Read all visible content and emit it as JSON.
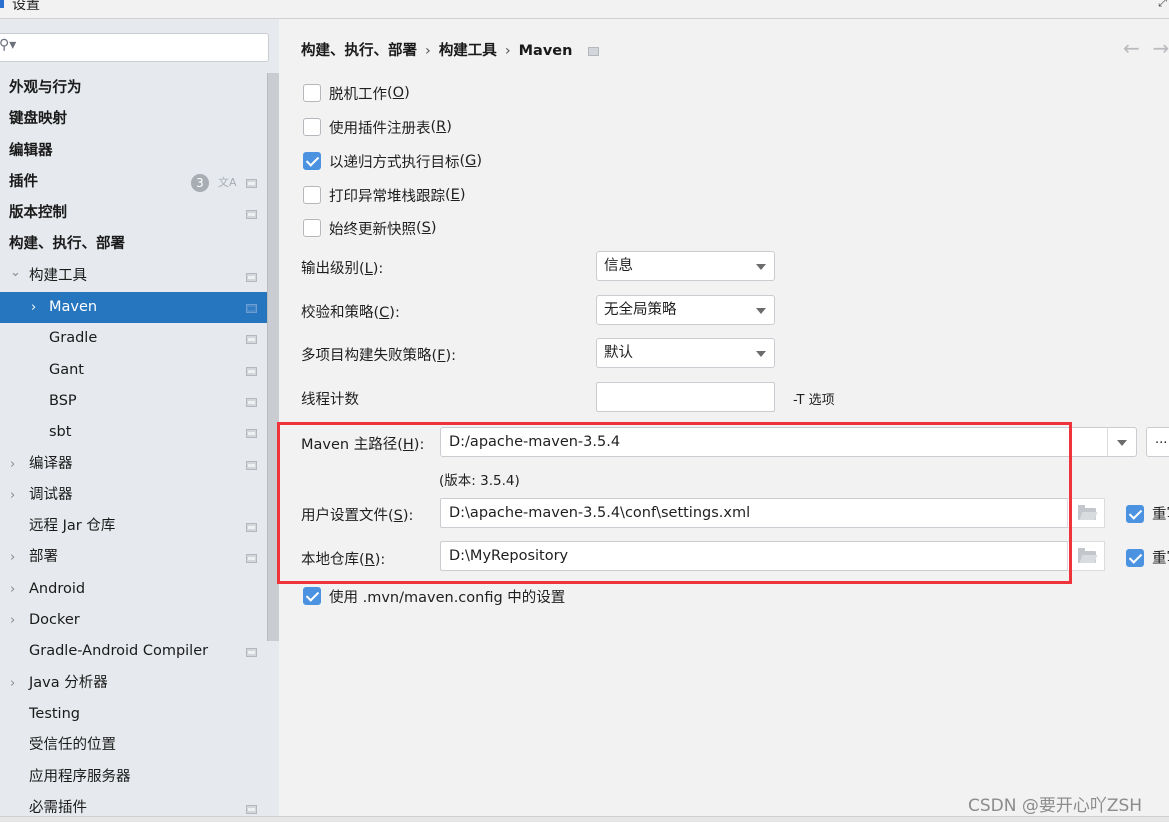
{
  "window": {
    "title": "设置"
  },
  "sidebar": {
    "search_placeholder": "",
    "items": [
      {
        "label": "外观与行为",
        "bold": true,
        "indent": 0,
        "chevron": "",
        "project_icon": false
      },
      {
        "label": "键盘映射",
        "bold": true,
        "indent": 0,
        "chevron": "",
        "project_icon": false
      },
      {
        "label": "编辑器",
        "bold": true,
        "indent": 0,
        "chevron": "",
        "project_icon": false
      },
      {
        "label": "插件",
        "bold": true,
        "indent": 0,
        "chevron": "",
        "project_icon": true,
        "badge": "3",
        "translate_icon": true
      },
      {
        "label": "版本控制",
        "bold": true,
        "indent": 0,
        "chevron": "",
        "project_icon": true
      },
      {
        "label": "构建、执行、部署",
        "bold": true,
        "indent": 0,
        "chevron": "",
        "project_icon": false
      },
      {
        "label": "构建工具",
        "bold": false,
        "indent": 1,
        "chevron": "expanded",
        "project_icon": true
      },
      {
        "label": "Maven",
        "bold": false,
        "indent": 2,
        "chevron": "collapsed",
        "project_icon": true,
        "selected": true
      },
      {
        "label": "Gradle",
        "bold": false,
        "indent": 2,
        "chevron": "",
        "project_icon": true
      },
      {
        "label": "Gant",
        "bold": false,
        "indent": 2,
        "chevron": "",
        "project_icon": true
      },
      {
        "label": "BSP",
        "bold": false,
        "indent": 2,
        "chevron": "",
        "project_icon": true
      },
      {
        "label": "sbt",
        "bold": false,
        "indent": 2,
        "chevron": "",
        "project_icon": true
      },
      {
        "label": "编译器",
        "bold": false,
        "indent": 1,
        "chevron": "collapsed",
        "project_icon": true
      },
      {
        "label": "调试器",
        "bold": false,
        "indent": 1,
        "chevron": "collapsed",
        "project_icon": false
      },
      {
        "label": "远程 Jar 仓库",
        "bold": false,
        "indent": 1,
        "chevron": "",
        "project_icon": true
      },
      {
        "label": "部署",
        "bold": false,
        "indent": 1,
        "chevron": "collapsed",
        "project_icon": true
      },
      {
        "label": "Android",
        "bold": false,
        "indent": 1,
        "chevron": "collapsed",
        "project_icon": false
      },
      {
        "label": "Docker",
        "bold": false,
        "indent": 1,
        "chevron": "collapsed",
        "project_icon": false
      },
      {
        "label": "Gradle-Android Compiler",
        "bold": false,
        "indent": 1,
        "chevron": "",
        "project_icon": true
      },
      {
        "label": "Java 分析器",
        "bold": false,
        "indent": 1,
        "chevron": "collapsed",
        "project_icon": false
      },
      {
        "label": "Testing",
        "bold": false,
        "indent": 1,
        "chevron": "",
        "project_icon": false
      },
      {
        "label": "受信任的位置",
        "bold": false,
        "indent": 1,
        "chevron": "",
        "project_icon": false
      },
      {
        "label": "应用程序服务器",
        "bold": false,
        "indent": 1,
        "chevron": "",
        "project_icon": false
      },
      {
        "label": "必需插件",
        "bold": false,
        "indent": 1,
        "chevron": "",
        "project_icon": true
      }
    ]
  },
  "breadcrumb": {
    "parts": [
      "构建、执行、部署",
      "构建工具",
      "Maven"
    ]
  },
  "options": {
    "work_offline": {
      "label": "脱机工作",
      "mnemonic": "O",
      "checked": false
    },
    "use_plugin_registry": {
      "label": "使用插件注册表",
      "mnemonic": "R",
      "checked": false
    },
    "recursive": {
      "label": "以递归方式执行目标",
      "mnemonic": "G",
      "checked": true
    },
    "print_stacktrace": {
      "label": "打印异常堆栈跟踪",
      "mnemonic": "E",
      "checked": false
    },
    "always_update": {
      "label": "始终更新快照",
      "mnemonic": "S",
      "checked": false
    }
  },
  "fields": {
    "output_level": {
      "label": "输出级别",
      "mnemonic": "L",
      "value": "信息"
    },
    "checksum_policy": {
      "label": "校验和策略",
      "mnemonic": "C",
      "value": "无全局策略"
    },
    "failure_policy": {
      "label": "多项目构建失败策略",
      "mnemonic": "F",
      "value": "默认"
    },
    "thread_count": {
      "label": "线程计数",
      "value": "",
      "hint": "-T 选项"
    },
    "maven_home": {
      "label_prefix": "Maven 主路径",
      "mnemonic": "H",
      "value": "D:/apache-maven-3.5.4",
      "more": "..."
    },
    "version": "(版本: 3.5.4)",
    "user_settings": {
      "label": "用户设置文件",
      "mnemonic": "S",
      "value": "D:\\apache-maven-3.5.4\\conf\\settings.xml",
      "override_checked": true,
      "override_label": "重写"
    },
    "local_repo": {
      "label": "本地仓库",
      "mnemonic": "R",
      "value": "D:\\MyRepository",
      "override_checked": true,
      "override_label": "重写"
    },
    "use_mvn_config": {
      "label": "使用 .mvn/maven.config 中的设置",
      "checked": true
    }
  },
  "watermark": "CSDN @要开心吖ZSH"
}
